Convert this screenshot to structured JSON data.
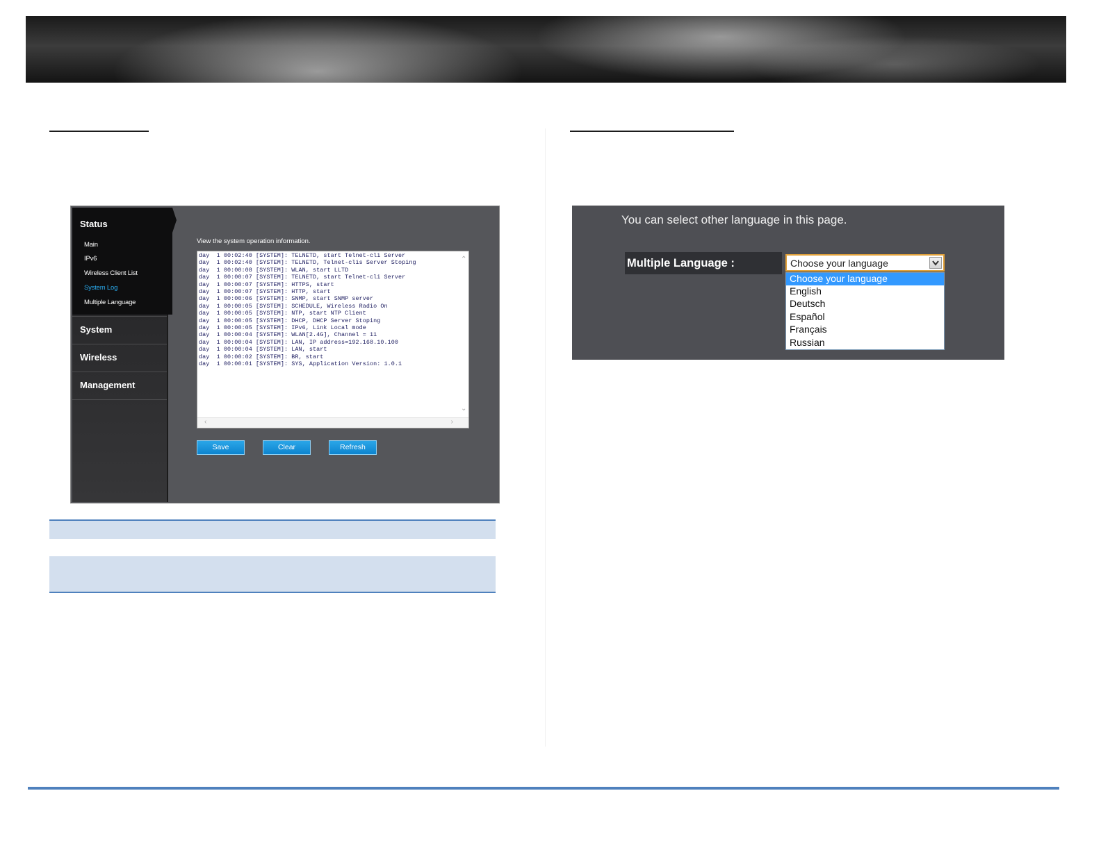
{
  "router": {
    "sidebar": {
      "status_title": "Status",
      "status_items": [
        "Main",
        "IPv6",
        "Wireless Client List",
        "System Log",
        "Multiple Language"
      ],
      "sections": [
        "System",
        "Wireless",
        "Management"
      ]
    },
    "description": "View the system operation information.",
    "log_lines": [
      "day  1 00:02:40 [SYSTEM]: TELNETD, start Telnet-cli Server",
      "day  1 00:02:40 [SYSTEM]: TELNETD, Telnet-clis Server Stoping",
      "day  1 00:00:08 [SYSTEM]: WLAN, start LLTD",
      "day  1 00:00:07 [SYSTEM]: TELNETD, start Telnet-cli Server",
      "day  1 00:00:07 [SYSTEM]: HTTPS, start",
      "day  1 00:00:07 [SYSTEM]: HTTP, start",
      "day  1 00:00:06 [SYSTEM]: SNMP, start SNMP server",
      "day  1 00:00:05 [SYSTEM]: SCHEDULE, Wireless Radio On",
      "day  1 00:00:05 [SYSTEM]: NTP, start NTP Client",
      "day  1 00:00:05 [SYSTEM]: DHCP, DHCP Server Stoping",
      "day  1 00:00:05 [SYSTEM]: IPv6, Link Local mode",
      "day  1 00:00:04 [SYSTEM]: WLAN[2.4G], Channel = 11",
      "day  1 00:00:04 [SYSTEM]: LAN, IP address=192.168.10.100",
      "day  1 00:00:04 [SYSTEM]: LAN, start",
      "day  1 00:00:02 [SYSTEM]: BR, start",
      "day  1 00:00:01 [SYSTEM]: SYS, Application Version: 1.0.1"
    ],
    "buttons": {
      "save": "Save",
      "clear": "Clear",
      "refresh": "Refresh"
    }
  },
  "language": {
    "intro": "You can select other language in this page.",
    "label": "Multiple Language :",
    "selected": "Choose your language",
    "options": [
      "Choose your language",
      "English",
      "Deutsch",
      "Español",
      "Français",
      "Russian"
    ],
    "highlight_color": "#3399ff",
    "select_border_color": "#e2a23b"
  },
  "colors": {
    "table_fill": "#d3dfee",
    "table_rule": "#4f81bd",
    "active_nav": "#2aa8ea",
    "button": "#1596dc"
  }
}
